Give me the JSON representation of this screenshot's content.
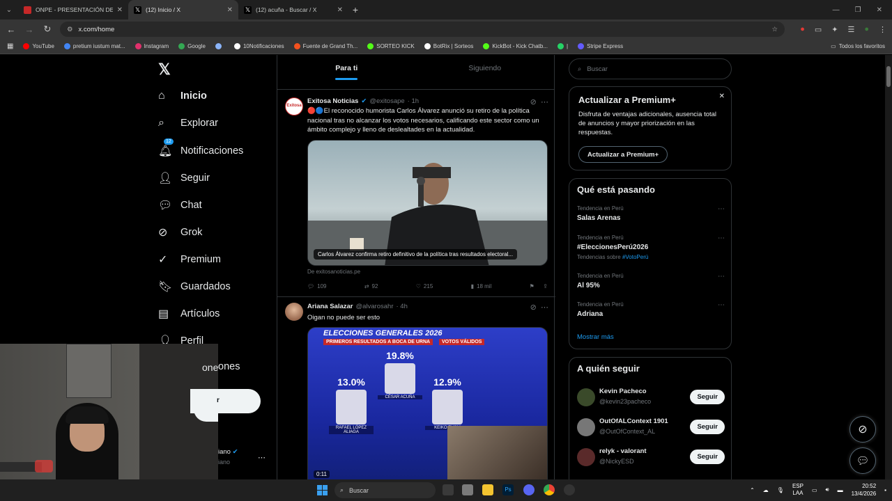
{
  "browser": {
    "tabs": [
      {
        "title": "ONPE - PRESENTACIÓN DE RES",
        "favicon_color": "#c62828"
      },
      {
        "title": "(12) Inicio / X",
        "favicon_color": "#000000"
      },
      {
        "title": "(12) acuña - Buscar / X",
        "favicon_color": "#000000"
      }
    ],
    "url": "x.com/home",
    "bookmarks": [
      {
        "label": "YouTube",
        "color": "#ff0000"
      },
      {
        "label": "pretium iustum mat...",
        "color": "#4285f4"
      },
      {
        "label": "Instagram",
        "color": "#e1306c"
      },
      {
        "label": "Google",
        "color": "#34a853"
      },
      {
        "label": "",
        "color": "#8ab4f8"
      },
      {
        "label": "10Notificaciones",
        "color": "#ffffff"
      },
      {
        "label": "Fuente de Grand Th...",
        "color": "#f4511e"
      },
      {
        "label": "SORTEO KICK",
        "color": "#53fc18"
      },
      {
        "label": "BotRix | Sorteos",
        "color": "#ffffff"
      },
      {
        "label": "KickBot - Kick Chatb...",
        "color": "#53fc18"
      },
      {
        "label": "|",
        "color": "#25d366"
      },
      {
        "label": "Stripe Express",
        "color": "#635bff"
      }
    ],
    "all_favorites": "Todos los favoritos"
  },
  "nav": {
    "items": [
      {
        "label": "Inicio",
        "icon": "home-icon"
      },
      {
        "label": "Explorar",
        "icon": "search-icon"
      },
      {
        "label": "Notificaciones",
        "icon": "bell-icon",
        "badge": "12"
      },
      {
        "label": "Seguir",
        "icon": "follow-icon"
      },
      {
        "label": "Chat",
        "icon": "chat-icon"
      },
      {
        "label": "Grok",
        "icon": "grok-icon"
      },
      {
        "label": "Premium",
        "icon": "premium-icon"
      },
      {
        "label": "Guardados",
        "icon": "bookmark-icon"
      },
      {
        "label": "Artículos",
        "icon": "articles-icon"
      },
      {
        "label": "Perfil",
        "icon": "profile-icon"
      }
    ],
    "partial_more": "ones",
    "partial_post": "r",
    "partial_user_name": "iano",
    "partial_user_handle": "iano"
  },
  "feed": {
    "tabs": [
      "Para ti",
      "Siguiendo"
    ],
    "tweet1": {
      "name": "Exitosa Noticias",
      "handle": "@exitosape",
      "time": "· 1h",
      "text": "🔴🔵El reconocido humorista Carlos Álvarez anunció su retiro de la política nacional tras no alcanzar los votos necesarios, calificando este sector como un ámbito complejo y lleno de deslealtades en la actualidad.",
      "caption": "Carlos Álvarez confirma retiro definitivo de la política tras resultados electoral...",
      "source": "De exitosanoticias.pe",
      "replies": "109",
      "reposts": "92",
      "likes": "215",
      "views": "18 mil"
    },
    "tweet2": {
      "name": "Ariana Salazar",
      "handle": "@alvarosahr",
      "time": "· 4h",
      "text": "Oigan no puede ser esto",
      "banner": "ELECCIONES GENERALES 2026",
      "subbanner": "PRIMEROS RESULTADOS A BOCA DE URNA",
      "votos": "VOTOS VÁLIDOS",
      "candidates": [
        {
          "pct": "13.0%",
          "name": "RAFAEL LÓPEZ ALIAGA",
          "value": 13.0
        },
        {
          "pct": "19.8%",
          "name": "CÉSAR ACUÑA",
          "value": 19.8
        },
        {
          "pct": "12.9%",
          "name": "KEIKO FUJIM",
          "value": 12.9
        }
      ],
      "video_time": "0:11"
    }
  },
  "sidebar": {
    "search_placeholder": "Buscar",
    "premium": {
      "title": "Actualizar a Premium+",
      "body": "Disfruta de ventajas adicionales, ausencia total de anuncios y mayor priorización en las respuestas.",
      "button": "Actualizar a Premium+"
    },
    "trends_title": "Qué está pasando",
    "trends": [
      {
        "category": "Tendencia en Perú",
        "name": "Salas Arenas"
      },
      {
        "category": "Tendencia en Perú",
        "name": "#EleccionesPerú2026",
        "sub": "Tendencias sobre",
        "sub_link": "#VotoPerú"
      },
      {
        "category": "Tendencia en Perú",
        "name": "Al 95%"
      },
      {
        "category": "Tendencia en Perú",
        "name": "Adriana"
      }
    ],
    "show_more": "Mostrar más",
    "follow_title": "A quién seguir",
    "follow": [
      {
        "name": "Kevin Pacheco",
        "handle": "@kevin23pacheco",
        "button": "Seguir"
      },
      {
        "name": "OutOfALContext 1901",
        "handle": "@OutOfContext_AL",
        "button": "Seguir"
      },
      {
        "name": "relyk - valorant",
        "handle": "@NickyESD",
        "button": "Seguir"
      }
    ]
  },
  "taskbar": {
    "search": "Buscar",
    "lang1": "ESP",
    "lang2": "LAA",
    "time": "20:52",
    "date": "13/4/2026"
  }
}
